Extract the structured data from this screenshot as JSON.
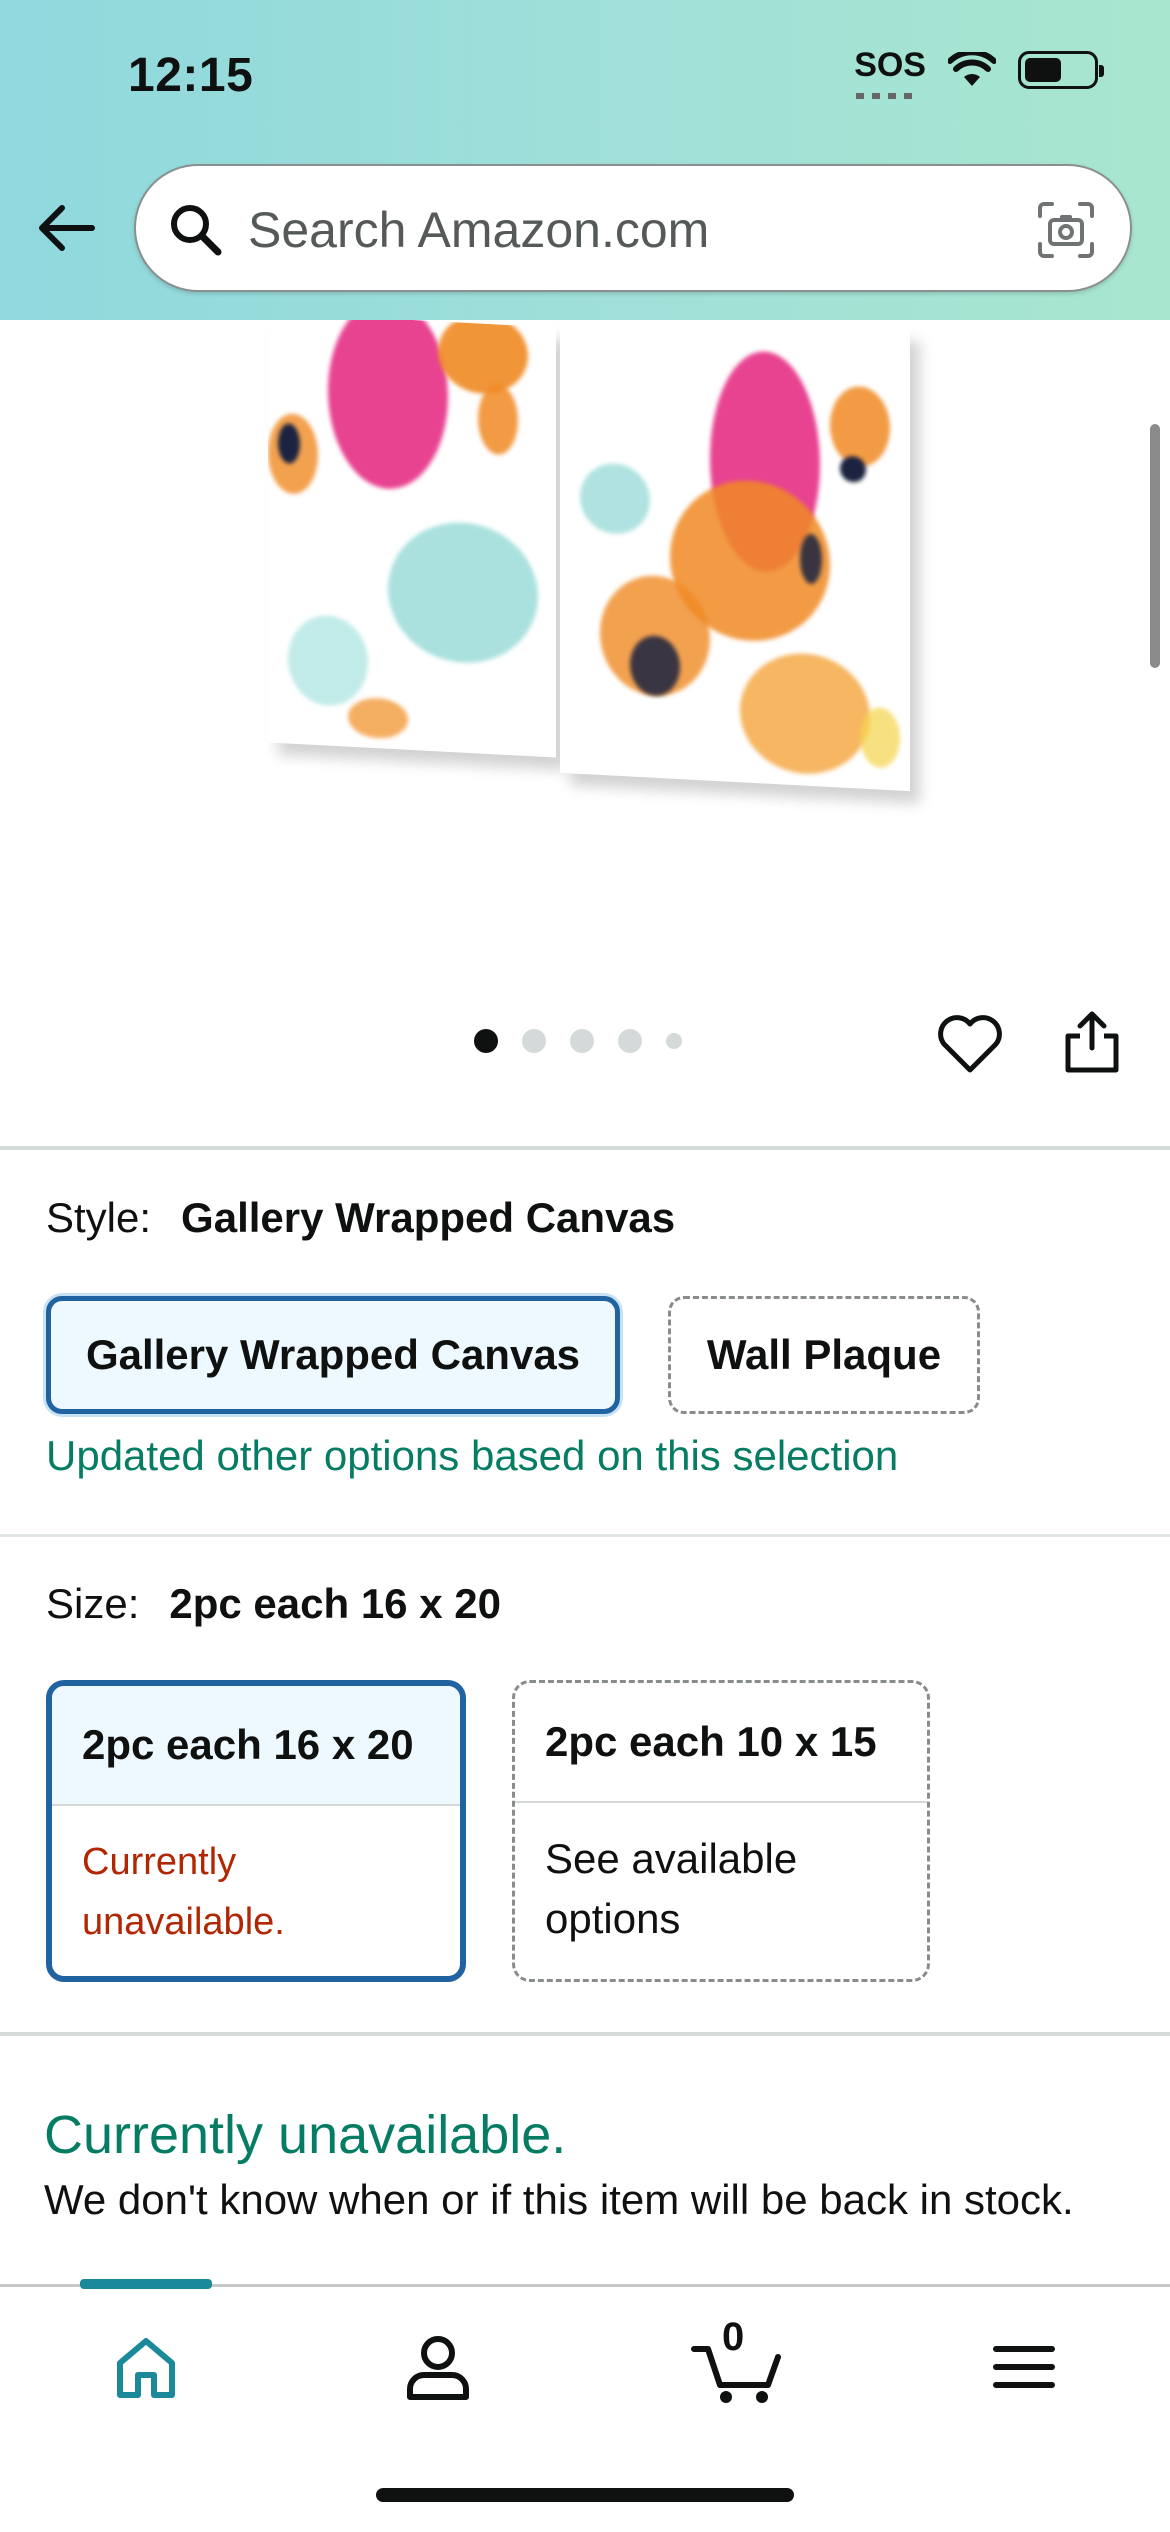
{
  "status_bar": {
    "time": "12:15",
    "sos": "SOS"
  },
  "search": {
    "placeholder": "Search Amazon.com"
  },
  "gallery": {
    "dot_count": 5,
    "active_dot": 1
  },
  "style": {
    "label": "Style:",
    "value": "Gallery Wrapped Canvas",
    "options": [
      "Gallery Wrapped Canvas",
      "Wall Plaque"
    ],
    "note": "Updated other options based on this selection"
  },
  "size": {
    "label": "Size:",
    "value": "2pc each 16 x 20",
    "options": [
      {
        "title": "2pc each 16 x 20",
        "line1": "Currently",
        "line2": "unavailable."
      },
      {
        "title": "2pc each 10 x 15",
        "line1": "See available",
        "line2": "options"
      }
    ]
  },
  "availability": {
    "title": "Currently unavailable.",
    "text": "We don't know when or if this item will be back in stock."
  },
  "bottom_nav": {
    "cart_count": "0"
  },
  "colors": {
    "accent": "#2162a1",
    "success": "#067d62",
    "error": "#b12704",
    "header_start": "#8fd8dd",
    "header_end": "#a9e6cf"
  },
  "icons": [
    "back-arrow-icon",
    "search-icon",
    "camera-icon",
    "heart-icon",
    "share-icon",
    "home-icon",
    "account-icon",
    "cart-icon",
    "menu-icon"
  ]
}
